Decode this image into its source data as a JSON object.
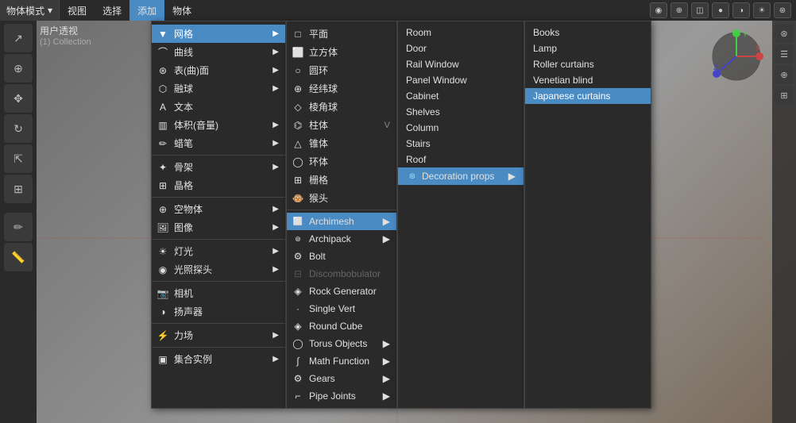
{
  "topbar": {
    "mode_label": "物体模式",
    "menus": [
      "视图",
      "选择",
      "添加",
      "物体"
    ],
    "active_menu": "添加"
  },
  "viewport": {
    "header": "用户透视",
    "collection": "(1) Collection"
  },
  "menu_l1": {
    "items": [
      {
        "id": "mesh",
        "icon": "▼",
        "label": "网格",
        "has_sub": true,
        "active": true
      },
      {
        "id": "curve",
        "icon": "~",
        "label": "曲线",
        "has_sub": true
      },
      {
        "id": "surface",
        "icon": "#",
        "label": "表(曲)面",
        "has_sub": true
      },
      {
        "id": "metaball",
        "icon": "⬡",
        "label": "融球",
        "has_sub": true
      },
      {
        "id": "text",
        "icon": "A",
        "label": "文本",
        "has_sub": false
      },
      {
        "id": "volume",
        "icon": "▥",
        "label": "体积(音量)",
        "has_sub": true
      },
      {
        "id": "greasepencil",
        "icon": "✏",
        "label": "蜡笔",
        "has_sub": true
      },
      {
        "id": "armature",
        "icon": "✦",
        "label": "骨架",
        "has_sub": true
      },
      {
        "id": "lattice",
        "icon": "⊞",
        "label": "晶格",
        "has_sub": false
      },
      {
        "id": "empty",
        "icon": "⊕",
        "label": "空物体",
        "has_sub": true
      },
      {
        "id": "image",
        "icon": "🖼",
        "label": "图像",
        "has_sub": true
      },
      {
        "id": "light",
        "icon": "☀",
        "label": "灯光",
        "has_sub": true
      },
      {
        "id": "lightprobe",
        "icon": "◉",
        "label": "光照探头",
        "has_sub": true
      },
      {
        "id": "camera",
        "icon": "📷",
        "label": "相机",
        "has_sub": false
      },
      {
        "id": "speaker",
        "icon": "🔊",
        "label": "扬声器",
        "has_sub": false
      },
      {
        "id": "forcefield",
        "icon": "⚡",
        "label": "力场",
        "has_sub": true
      },
      {
        "id": "collection",
        "icon": "▣",
        "label": "集合实例",
        "has_sub": true
      }
    ]
  },
  "menu_l2_mesh": {
    "items": [
      {
        "id": "plane",
        "icon": "□",
        "label": "平面"
      },
      {
        "id": "cube",
        "icon": "⬜",
        "label": "立方体"
      },
      {
        "id": "circle",
        "icon": "○",
        "label": "圆环"
      },
      {
        "id": "uvsphere",
        "icon": "⊕",
        "label": "经纬球"
      },
      {
        "id": "icosphere",
        "icon": "◇",
        "label": "棱角球"
      },
      {
        "id": "cylinder",
        "icon": "⌬",
        "label": "柱体",
        "shortcut": "V"
      },
      {
        "id": "cone",
        "icon": "△",
        "label": "锥体"
      },
      {
        "id": "torus",
        "icon": "◯",
        "label": "环体"
      },
      {
        "id": "grid",
        "icon": "⊞",
        "label": "栅格"
      },
      {
        "id": "monkey",
        "icon": "🐵",
        "label": "猴头"
      }
    ],
    "extra_items": [
      {
        "id": "archimesh",
        "icon": "⬜",
        "label": "Archimesh",
        "has_sub": true,
        "active": true
      },
      {
        "id": "archipack",
        "icon": "",
        "label": "Archipack",
        "has_sub": true
      },
      {
        "id": "bolt",
        "icon": "⚙",
        "label": "Bolt"
      },
      {
        "id": "discombobulator",
        "icon": "⊟",
        "label": "Discombobulator",
        "disabled": true
      },
      {
        "id": "rock",
        "icon": "◈",
        "label": "Rock Generator"
      },
      {
        "id": "singlevert",
        "icon": "·",
        "label": "Single Vert"
      },
      {
        "id": "roundcube",
        "icon": "◈",
        "label": "Round Cube"
      },
      {
        "id": "torusobjects",
        "icon": "◯",
        "label": "Torus Objects",
        "has_sub": true
      },
      {
        "id": "mathfunction",
        "icon": "∫",
        "label": "Math Function",
        "has_sub": true
      },
      {
        "id": "gears",
        "icon": "⚙",
        "label": "Gears",
        "has_sub": true
      },
      {
        "id": "pipejoints",
        "icon": "⌐",
        "label": "Pipe Joints",
        "has_sub": true
      }
    ]
  },
  "menu_l3_archimesh": {
    "items": [
      {
        "id": "room",
        "label": "Room"
      },
      {
        "id": "door",
        "label": "Door"
      },
      {
        "id": "railwindow",
        "label": "Rail Window"
      },
      {
        "id": "panelwindow",
        "label": "Panel Window"
      },
      {
        "id": "cabinet",
        "label": "Cabinet"
      },
      {
        "id": "shelves",
        "label": "Shelves"
      },
      {
        "id": "column",
        "label": "Column"
      },
      {
        "id": "stairs",
        "label": "Stairs"
      },
      {
        "id": "roof",
        "label": "Roof"
      },
      {
        "id": "decorationprops",
        "label": "Decoration props",
        "has_sub": true,
        "active": true
      }
    ]
  },
  "menu_l4_decoration": {
    "items": [
      {
        "id": "books",
        "label": "Books"
      },
      {
        "id": "lamp",
        "label": "Lamp"
      },
      {
        "id": "rollercurtains",
        "label": "Roller curtains"
      },
      {
        "id": "venetianblind",
        "label": "Venetian blind"
      },
      {
        "id": "japanesecurtains",
        "label": "Japanese curtains",
        "selected": true
      }
    ]
  }
}
